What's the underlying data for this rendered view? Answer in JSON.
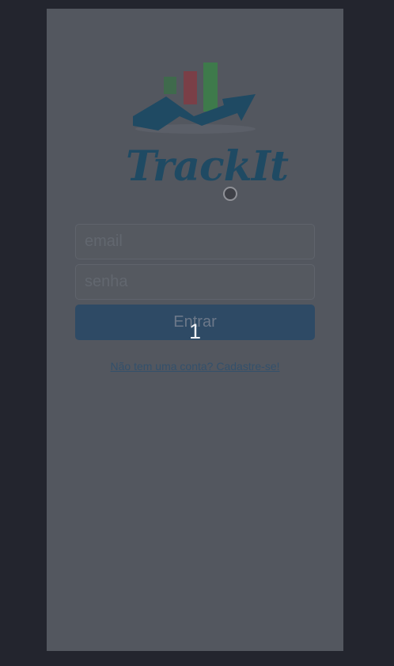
{
  "brand": {
    "name": "TrackIt",
    "colors": {
      "primary": "#1f4a63",
      "bar_green_1": "#3f6a4c",
      "bar_red": "#7a3f47",
      "bar_green_2": "#3e7a4b"
    }
  },
  "cursor": {
    "icon": "cursor-dot-icon"
  },
  "form": {
    "email_placeholder": "email",
    "password_placeholder": "senha",
    "submit_label": "Entrar"
  },
  "click_marker": "1",
  "signup_link": "Não tem uma conta? Cadastre-se!",
  "colors": {
    "background": "#23252e",
    "frame": "#53575f",
    "button": "#2e4a65"
  }
}
